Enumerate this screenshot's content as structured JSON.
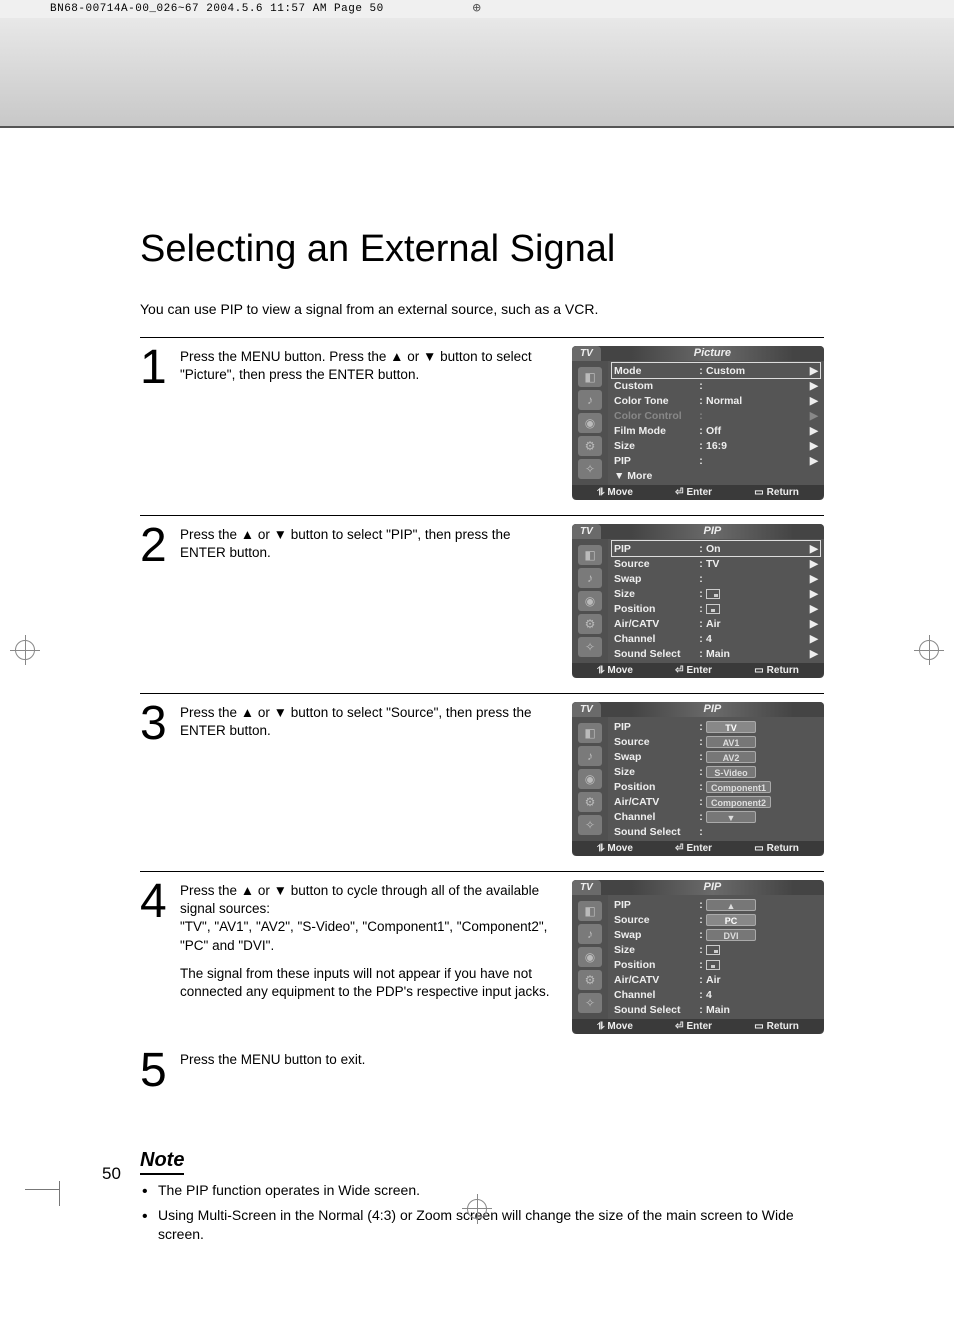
{
  "crop_header": "BN68-00714A-00_026~67  2004.5.6  11:57 AM  Page 50",
  "title": "Selecting an External Signal",
  "intro": "You can use PIP to view a signal from an external source, such as a VCR.",
  "steps": {
    "s1": {
      "num": "1",
      "text": "Press the MENU button. Press the ▲ or ▼ button to select \"Picture\", then press the ENTER button."
    },
    "s2": {
      "num": "2",
      "text": "Press the ▲ or ▼ button to select \"PIP\", then press the ENTER button."
    },
    "s3": {
      "num": "3",
      "text": "Press the ▲ or ▼ button to select \"Source\", then press the ENTER button."
    },
    "s4": {
      "num": "4",
      "p1": "Press the ▲ or ▼ button to cycle through all of the available signal sources:",
      "p2": "\"TV\", \"AV1\", \"AV2\", \"S-Video\", \"Component1\", \"Component2\", \"PC\" and \"DVI\".",
      "p3": "The signal from these inputs will not appear if you have not connected any equipment to the PDP's respective input jacks."
    },
    "s5": {
      "num": "5",
      "text": "Press the MENU button to exit."
    }
  },
  "osd": {
    "tv": "TV",
    "footer": {
      "move": "Move",
      "enter": "Enter",
      "return": "Return"
    },
    "screen1": {
      "title": "Picture",
      "rows": [
        {
          "label": "Mode",
          "val": "Custom",
          "arrow": true,
          "sel": true
        },
        {
          "label": "Custom",
          "val": "",
          "arrow": true
        },
        {
          "label": "Color Tone",
          "val": "Normal",
          "arrow": true
        },
        {
          "label": "Color Control",
          "val": "",
          "arrow": true,
          "dim": true
        },
        {
          "label": "Film Mode",
          "val": "Off",
          "arrow": true
        },
        {
          "label": "Size",
          "val": "16:9",
          "arrow": true
        },
        {
          "label": "PIP",
          "val": "",
          "arrow": true
        },
        {
          "label": "▼ More",
          "val": "",
          "noColon": true
        }
      ]
    },
    "screen2": {
      "title": "PIP",
      "rows": [
        {
          "label": "PIP",
          "val": "On",
          "arrow": true,
          "sel": true
        },
        {
          "label": "Source",
          "val": "TV",
          "arrow": true
        },
        {
          "label": "Swap",
          "val": "",
          "arrow": true
        },
        {
          "label": "Size",
          "valIcon": "br",
          "arrow": true
        },
        {
          "label": "Position",
          "valIcon": "bc",
          "arrow": true
        },
        {
          "label": "Air/CATV",
          "val": "Air",
          "arrow": true
        },
        {
          "label": "Channel",
          "val": "4",
          "arrow": true
        },
        {
          "label": "Sound Select",
          "val": "Main",
          "arrow": true
        }
      ]
    },
    "screen3": {
      "title": "PIP",
      "rows": [
        {
          "label": "PIP",
          "pill": "TV",
          "pillSel": true
        },
        {
          "label": "Source",
          "pill": "AV1"
        },
        {
          "label": "Swap",
          "pill": "AV2"
        },
        {
          "label": "Size",
          "pill": "S-Video"
        },
        {
          "label": "Position",
          "pill": "Component1"
        },
        {
          "label": "Air/CATV",
          "pill": "Component2"
        },
        {
          "label": "Channel",
          "pill": "▼"
        },
        {
          "label": "Sound Select",
          "val": ""
        }
      ]
    },
    "screen4": {
      "title": "PIP",
      "rows": [
        {
          "label": "PIP",
          "pill": "▲"
        },
        {
          "label": "Source",
          "pill": "PC",
          "pillSel": true
        },
        {
          "label": "Swap",
          "pill": "DVI"
        },
        {
          "label": "Size",
          "valIcon": "br"
        },
        {
          "label": "Position",
          "valIcon": "bc"
        },
        {
          "label": "Air/CATV",
          "val": "Air"
        },
        {
          "label": "Channel",
          "val": "4"
        },
        {
          "label": "Sound Select",
          "val": "Main"
        }
      ]
    }
  },
  "note": {
    "heading": "Note",
    "items": [
      "The PIP function operates in Wide screen.",
      "Using Multi-Screen in the Normal (4:3) or Zoom screen will change the size of the main screen to Wide screen."
    ]
  },
  "page_number": "50"
}
